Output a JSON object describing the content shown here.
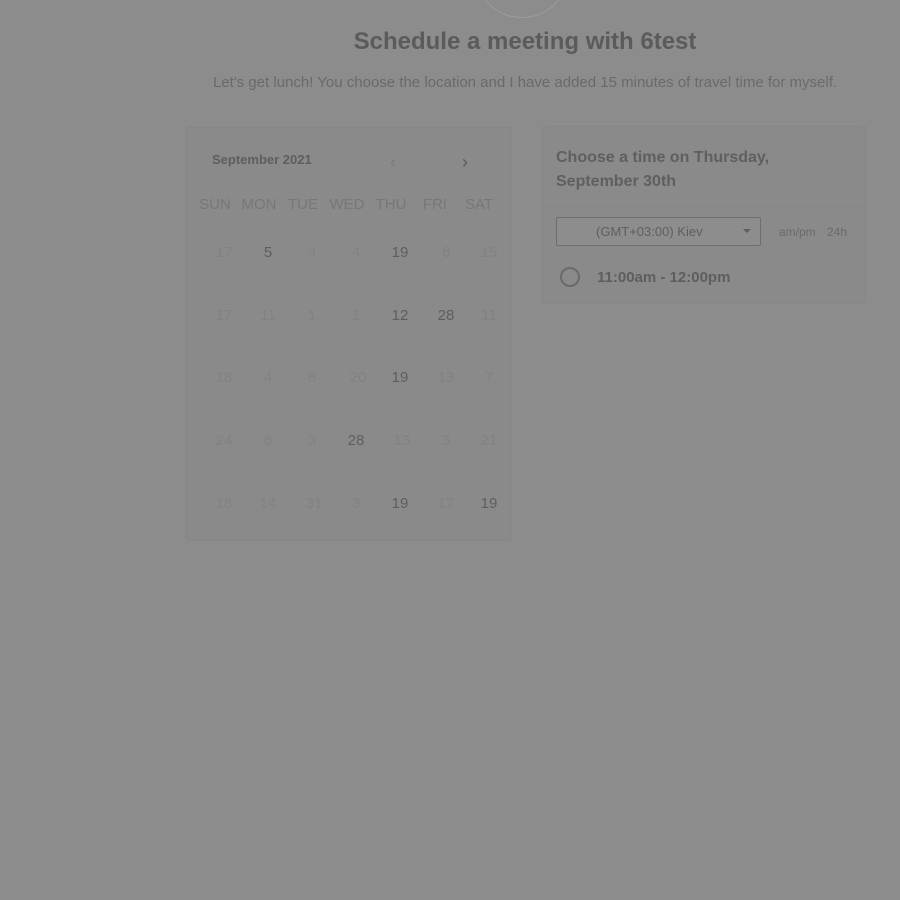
{
  "header": {
    "title": "Schedule a meeting with 6test",
    "description": "Let's get lunch! You choose the location and I have added 15 minutes of travel time for myself."
  },
  "calendar": {
    "month_label": "September 2021",
    "prev_icon": "chevron-left-icon",
    "next_icon": "chevron-right-icon",
    "weekdays": [
      "SUN",
      "MON",
      "TUE",
      "WED",
      "THU",
      "FRI",
      "SAT"
    ],
    "weeks": [
      [
        "17",
        "5",
        "4",
        "4",
        "19",
        "6",
        "15"
      ],
      [
        "17",
        "11",
        "1",
        "1",
        "12",
        "28",
        "11"
      ],
      [
        "18",
        "4",
        "8",
        "20",
        "19",
        "13",
        "7"
      ],
      [
        "24",
        "6",
        "3",
        "28",
        "13",
        "3",
        "21"
      ],
      [
        "18",
        "14",
        "31",
        "3",
        "19",
        "17",
        "19"
      ]
    ],
    "active_days": [
      [
        0,
        1
      ],
      [
        0,
        4
      ],
      [
        1,
        4
      ],
      [
        1,
        5
      ],
      [
        2,
        4
      ],
      [
        3,
        3
      ],
      [
        4,
        4
      ],
      [
        4,
        6
      ]
    ]
  },
  "timepicker": {
    "heading": "Choose a time on Thursday, September 30th",
    "timezone": "(GMT+03:00) Kiev",
    "format_ampm": "am/pm",
    "format_24h": "24h",
    "slots": [
      "11:00am - 12:00pm"
    ]
  },
  "colors": {
    "background": "#8c8c8c",
    "text_dark": "#5e5e5e",
    "text_dim": "#828282"
  }
}
